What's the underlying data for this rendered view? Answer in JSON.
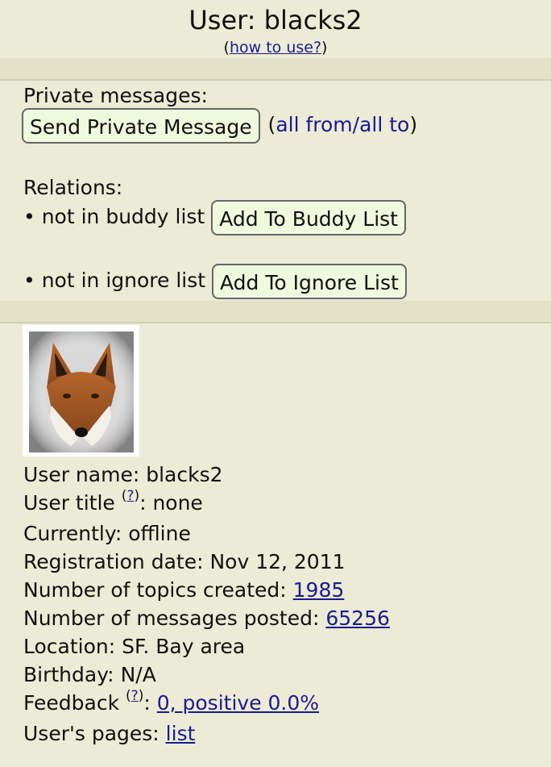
{
  "header": {
    "title": "User: blacks2",
    "howto_prefix": "(",
    "howto_link": "how to use?",
    "howto_suffix": ")"
  },
  "private_messages": {
    "label": "Private messages:",
    "send_button": "Send Private Message",
    "open_paren": "(",
    "all_from": "all from",
    "slash": "/",
    "all_to": "all to",
    "close_paren": ")"
  },
  "relations": {
    "label": "Relations:",
    "buddy_status": "• not in buddy list",
    "buddy_button": "Add To Buddy List",
    "ignore_status": "• not in ignore list",
    "ignore_button": "Add To Ignore List"
  },
  "profile": {
    "avatar_icon": "fox-portrait-avatar",
    "user_name_label": "User name:",
    "user_name": "blacks2",
    "user_title_label": "User title",
    "help_mark": "?",
    "user_title": ": none",
    "currently_label": "Currently:",
    "currently": "offline",
    "registration_label": "Registration date:",
    "registration": "Nov 12, 2011",
    "topics_label": "Number of topics created:",
    "topics": "1985",
    "messages_label": "Number of messages posted:",
    "messages": "65256",
    "location_label": "Location:",
    "location": "SF. Bay area",
    "birthday_label": "Birthday:",
    "birthday": "N/A",
    "feedback_label": "Feedback",
    "feedback_colon": ":",
    "feedback": "0, positive 0.0%",
    "pages_label": "User's pages:",
    "pages": "list"
  },
  "colors": {
    "background": "#ecebd6",
    "link": "#1b1b8e",
    "button_bg": "#eff9dd"
  }
}
